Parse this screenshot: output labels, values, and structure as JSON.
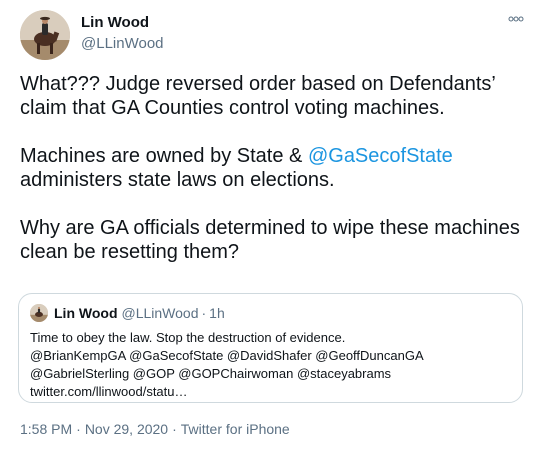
{
  "author": {
    "display_name": "Lin Wood",
    "handle": "@LLinWood"
  },
  "tweet": {
    "para1": "What??? Judge reversed order based on Defendants’ claim that GA Counties control voting machines.",
    "para2_before": "Machines are owned by State & ",
    "para2_mention": "@GaSecofState",
    "para2_after": " administers state laws on elections.",
    "para3": "Why are GA officials determined to wipe these machines clean be resetting them?"
  },
  "quote": {
    "display_name": "Lin Wood",
    "handle": "@LLinWood",
    "separator": "·",
    "time": "1h",
    "lines": [
      "Time to obey the law. Stop the destruction of evidence.",
      "@BrianKempGA @GaSecofState @DavidShafer @GeoffDuncanGA",
      "@GabrielSterling @GOP @GOPChairwoman @staceyabrams",
      "twitter.com/llinwood/statu…"
    ]
  },
  "meta": {
    "time": "1:58 PM",
    "separator": "·",
    "date": "Nov 29, 2020",
    "source": "Twitter for iPhone"
  },
  "icons": {
    "more": "more-options-icon",
    "avatar": "profile-photo"
  },
  "colors": {
    "text": "#0f1419",
    "secondary": "#5b7083",
    "link": "#1b95e0",
    "border": "#cfd9de"
  }
}
